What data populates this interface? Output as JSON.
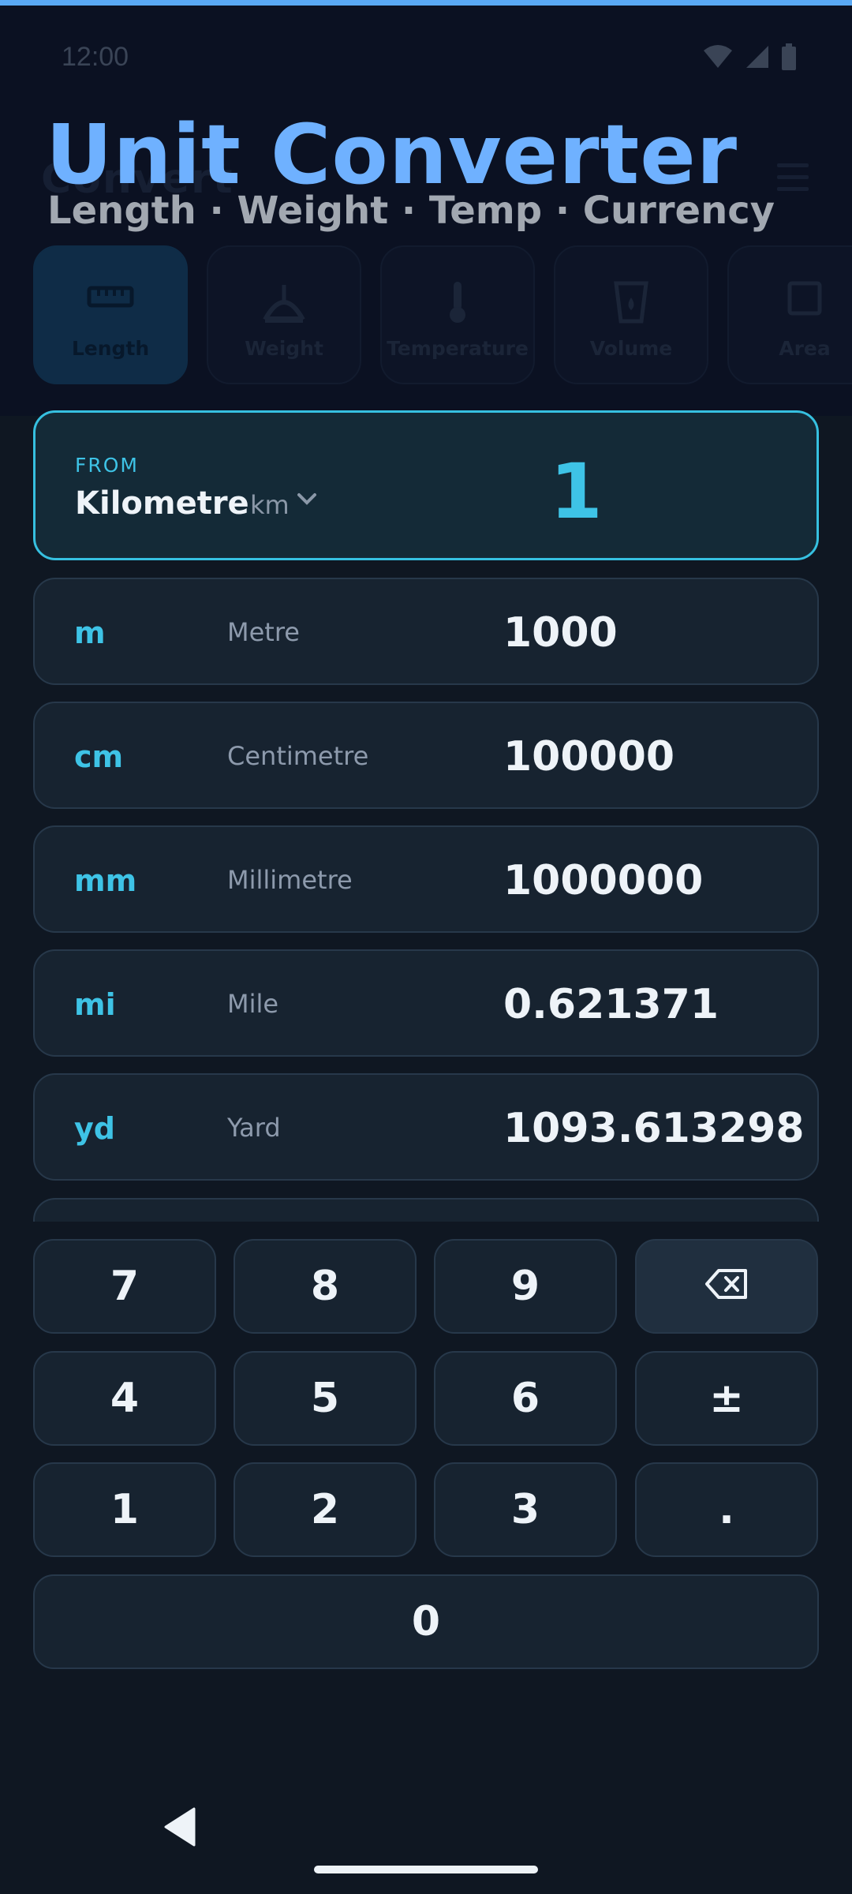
{
  "status_bar": {
    "time": "12:00"
  },
  "header": {
    "faint_title": "Convert",
    "title": "Unit Converter",
    "subtitle": "Length · Weight · Temp · Currency"
  },
  "categories": [
    {
      "label": "Length",
      "icon": "ruler-icon",
      "active": true
    },
    {
      "label": "Weight",
      "icon": "scale-icon",
      "active": false
    },
    {
      "label": "Temperature",
      "icon": "thermometer-icon",
      "active": false
    },
    {
      "label": "Volume",
      "icon": "cup-icon",
      "active": false
    },
    {
      "label": "Area",
      "icon": "square-icon",
      "active": false
    }
  ],
  "from": {
    "label": "FROM",
    "unit_name": "Kilometre",
    "unit_symbol": "km",
    "value": "1"
  },
  "results": [
    {
      "symbol": "m",
      "name": "Metre",
      "value": "1000"
    },
    {
      "symbol": "cm",
      "name": "Centimetre",
      "value": "100000"
    },
    {
      "symbol": "mm",
      "name": "Millimetre",
      "value": "1000000"
    },
    {
      "symbol": "mi",
      "name": "Mile",
      "value": "0.621371"
    },
    {
      "symbol": "yd",
      "name": "Yard",
      "value": "1093.613298"
    }
  ],
  "keypad": {
    "k7": "7",
    "k8": "8",
    "k9": "9",
    "k4": "4",
    "k5": "5",
    "k6": "6",
    "plus_minus": "±",
    "k1": "1",
    "k2": "2",
    "k3": "3",
    "dot": ".",
    "k0": "0"
  },
  "colors": {
    "accent": "#3ec3e6",
    "title": "#6fb1ff",
    "background": "#0f1722"
  }
}
